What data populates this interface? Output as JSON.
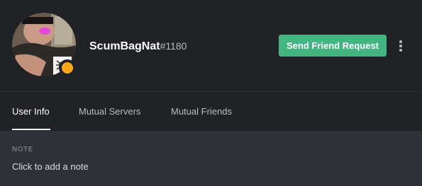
{
  "profile": {
    "username": "ScumBagNat",
    "discriminator": "#1180",
    "status": "idle",
    "status_color": "#faa61a",
    "send_friend_request_label": "Send Friend Request",
    "more_icon": "vertical-ellipsis-icon"
  },
  "tabs": [
    {
      "label": "User Info",
      "active": true
    },
    {
      "label": "Mutual Servers",
      "active": false
    },
    {
      "label": "Mutual Friends",
      "active": false
    }
  ],
  "note": {
    "label": "NOTE",
    "placeholder": "Click to add a note"
  },
  "colors": {
    "header_bg": "#202225",
    "body_bg": "#2f3136",
    "accent_green": "#43b581"
  }
}
